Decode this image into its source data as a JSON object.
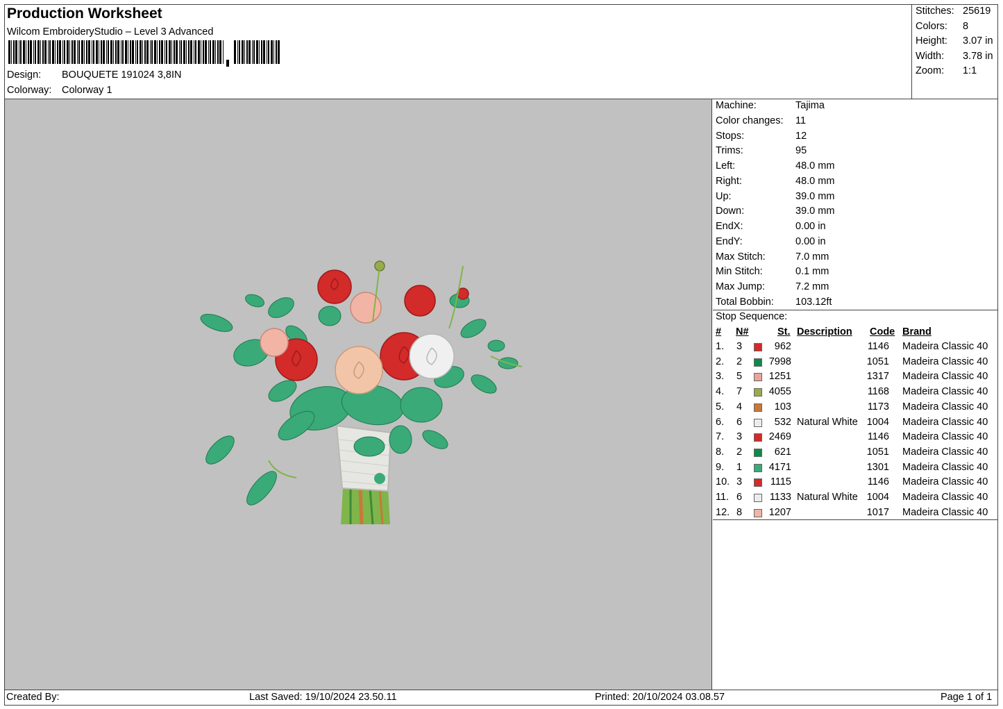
{
  "header": {
    "title": "Production Worksheet",
    "software": "Wilcom EmbroideryStudio – Level 3 Advanced",
    "design_label": "Design:",
    "design_value": "BOUQUETE 191024 3,8IN",
    "colorway_label": "Colorway:",
    "colorway_value": "Colorway 1"
  },
  "stats": [
    {
      "label": "Stitches:",
      "value": "25619"
    },
    {
      "label": "Colors:",
      "value": "8"
    },
    {
      "label": "Height:",
      "value": "3.07 in"
    },
    {
      "label": "Width:",
      "value": "3.78 in"
    },
    {
      "label": "Zoom:",
      "value": "1:1"
    }
  ],
  "machine_info": [
    {
      "label": "Machine:",
      "value": "Tajima"
    },
    {
      "label": "Color changes:",
      "value": "11"
    },
    {
      "label": "Stops:",
      "value": "12"
    },
    {
      "label": "Trims:",
      "value": "95"
    },
    {
      "label": "Left:",
      "value": "48.0 mm"
    },
    {
      "label": "Right:",
      "value": "48.0 mm"
    },
    {
      "label": "Up:",
      "value": "39.0 mm"
    },
    {
      "label": "Down:",
      "value": "39.0 mm"
    },
    {
      "label": "EndX:",
      "value": "0.00 in"
    },
    {
      "label": "EndY:",
      "value": "0.00 in"
    },
    {
      "label": "Max Stitch:",
      "value": "7.0 mm"
    },
    {
      "label": "Min Stitch:",
      "value": "0.1 mm"
    },
    {
      "label": "Max Jump:",
      "value": "7.2 mm"
    },
    {
      "label": "Total Bobbin:",
      "value": "103.12ft"
    }
  ],
  "stop_sequence": {
    "title": "Stop Sequence:",
    "columns": {
      "num": "#",
      "needle": "N#",
      "stitches": "St.",
      "description": "Description",
      "code": "Code",
      "brand": "Brand"
    },
    "rows": [
      {
        "num": "1.",
        "needle": "3",
        "color": "#d32a2a",
        "stitches": "962",
        "description": "",
        "code": "1146",
        "brand": "Madeira Classic 40"
      },
      {
        "num": "2.",
        "needle": "2",
        "color": "#0d8a4a",
        "stitches": "7998",
        "description": "",
        "code": "1051",
        "brand": "Madeira Classic 40"
      },
      {
        "num": "3.",
        "needle": "5",
        "color": "#e9a59a",
        "stitches": "1251",
        "description": "",
        "code": "1317",
        "brand": "Madeira Classic 40"
      },
      {
        "num": "4.",
        "needle": "7",
        "color": "#9aaa4e",
        "stitches": "4055",
        "description": "",
        "code": "1168",
        "brand": "Madeira Classic 40"
      },
      {
        "num": "5.",
        "needle": "4",
        "color": "#c8783a",
        "stitches": "103",
        "description": "",
        "code": "1173",
        "brand": "Madeira Classic 40"
      },
      {
        "num": "6.",
        "needle": "6",
        "color": "#ececf0",
        "stitches": "532",
        "description": "Natural White",
        "code": "1004",
        "brand": "Madeira Classic 40"
      },
      {
        "num": "7.",
        "needle": "3",
        "color": "#d32a2a",
        "stitches": "2469",
        "description": "",
        "code": "1146",
        "brand": "Madeira Classic 40"
      },
      {
        "num": "8.",
        "needle": "2",
        "color": "#0d8a4a",
        "stitches": "621",
        "description": "",
        "code": "1051",
        "brand": "Madeira Classic 40"
      },
      {
        "num": "9.",
        "needle": "1",
        "color": "#3aaa78",
        "stitches": "4171",
        "description": "",
        "code": "1301",
        "brand": "Madeira Classic 40"
      },
      {
        "num": "10.",
        "needle": "3",
        "color": "#d32a2a",
        "stitches": "1115",
        "description": "",
        "code": "1146",
        "brand": "Madeira Classic 40"
      },
      {
        "num": "11.",
        "needle": "6",
        "color": "#ececf0",
        "stitches": "1133",
        "description": "Natural White",
        "code": "1004",
        "brand": "Madeira Classic 40"
      },
      {
        "num": "12.",
        "needle": "8",
        "color": "#f2b5a5",
        "stitches": "1207",
        "description": "",
        "code": "1017",
        "brand": "Madeira Classic 40"
      }
    ]
  },
  "footer": {
    "created_by": "Created By:",
    "last_saved": "Last Saved: 19/10/2024 23.50.11",
    "printed": "Printed: 20/10/2024 03.08.57",
    "page": "Page 1 of 1"
  },
  "colors": {
    "preview_background": "#c1c1c1",
    "leaf_green": "#3aaa78",
    "rose_red": "#d32a2a",
    "rose_peach": "#f2c5a8",
    "rose_white": "#f0f0f0"
  }
}
